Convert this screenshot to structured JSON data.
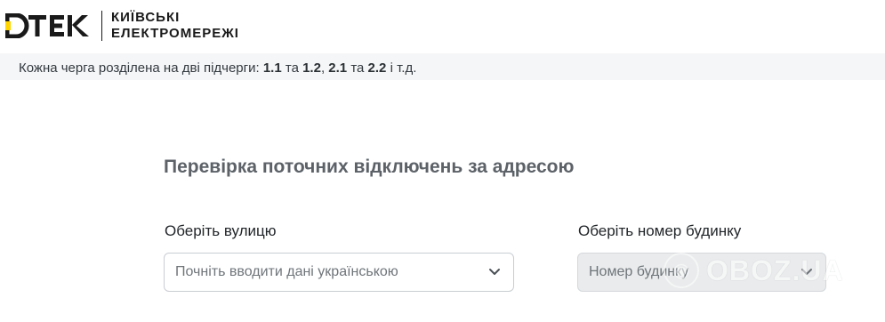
{
  "header": {
    "logo_mark_text": "DTEK",
    "company_name_line1": "КИЇВСЬКІ",
    "company_name_line2": "ЕЛЕКТРОМЕРЕЖІ"
  },
  "info": {
    "prefix": "Кожна черга розділена на дві підчерги: ",
    "q1": "1.1",
    "and1": " та ",
    "q2": "1.2",
    "comma": ", ",
    "q3": "2.1",
    "and2": " та ",
    "q4": "2.2",
    "suffix": " і т.д."
  },
  "form": {
    "title": "Перевірка поточних відключень за адресою",
    "street": {
      "label": "Оберіть вулицю",
      "placeholder": "Почніть вводити дані українською"
    },
    "house": {
      "label": "Оберіть номер будинку",
      "placeholder": "Номер будинку"
    }
  },
  "watermark": {
    "text": "OBOZ.UA"
  },
  "colors": {
    "brand_yellow": "#ffd400",
    "brand_dark": "#1a1a1a",
    "strip_bg": "#f5f6f7",
    "title_color": "#5c6268",
    "disabled_bg": "#e9ebec"
  }
}
